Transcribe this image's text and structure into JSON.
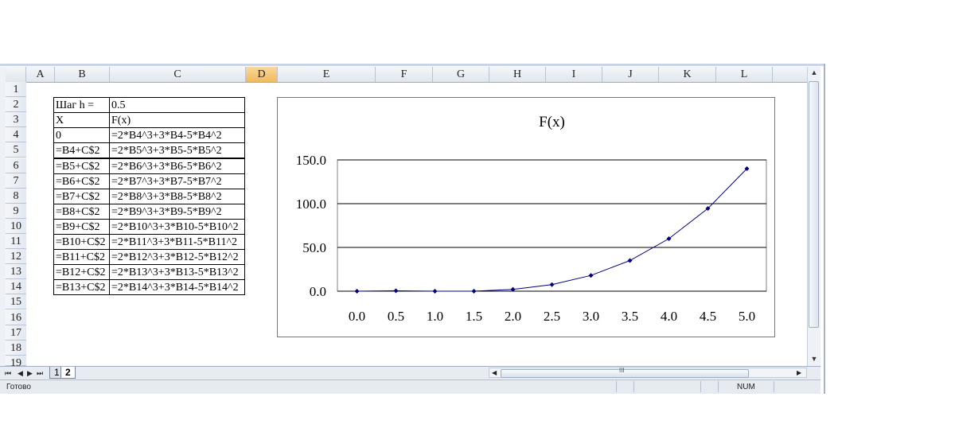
{
  "columns": [
    "A",
    "B",
    "C",
    "D",
    "E",
    "F",
    "G",
    "H",
    "I",
    "J",
    "K",
    "L"
  ],
  "selected_column": "D",
  "rows": [
    "1",
    "2",
    "3",
    "4",
    "5",
    "6",
    "7",
    "8",
    "9",
    "10",
    "11",
    "12",
    "13",
    "14",
    "15",
    "16",
    "17",
    "18",
    "19"
  ],
  "table": [
    [
      "Шаг h =",
      "0.5"
    ],
    [
      "X",
      "F(x)"
    ],
    [
      "0",
      "=2*B4^3+3*B4-5*B4^2"
    ],
    [
      "=B4+C$2",
      "=2*B5^3+3*B5-5*B5^2"
    ],
    [
      "=B5+C$2",
      "=2*B6^3+3*B6-5*B6^2"
    ],
    [
      "=B6+C$2",
      "=2*B7^3+3*B7-5*B7^2"
    ],
    [
      "=B7+C$2",
      "=2*B8^3+3*B8-5*B8^2"
    ],
    [
      "=B8+C$2",
      "=2*B9^3+3*B9-5*B9^2"
    ],
    [
      "=B9+C$2",
      "=2*B10^3+3*B10-5*B10^2"
    ],
    [
      "=B10+C$2",
      "=2*B11^3+3*B11-5*B11^2"
    ],
    [
      "=B11+C$2",
      "=2*B12^3+3*B12-5*B12^2"
    ],
    [
      "=B12+C$2",
      "=2*B13^3+3*B13-5*B13^2"
    ],
    [
      "=B13+C$2",
      "=2*B14^3+3*B14-5*B14^2"
    ]
  ],
  "chart_data": {
    "type": "line",
    "title": "F(x)",
    "xlabel": "",
    "ylabel": "",
    "categories": [
      "0.0",
      "0.5",
      "1.0",
      "1.5",
      "2.0",
      "2.5",
      "3.0",
      "3.5",
      "4.0",
      "4.5",
      "5.0"
    ],
    "series": [
      {
        "values": [
          0,
          0.5,
          0,
          0,
          2,
          7.5,
          18,
          35,
          60,
          94.5,
          140
        ]
      }
    ],
    "ylim": [
      0,
      150
    ],
    "yticks": [
      "0.0",
      "50.0",
      "100.0",
      "150.0"
    ],
    "grid": true,
    "legend": "none",
    "line_color": "#000080",
    "marker_color": "#000080"
  },
  "sheet_tabs": [
    "1",
    "2"
  ],
  "active_tab": "2",
  "nav_buttons": [
    "⏮",
    "◀",
    "▶",
    "⏭"
  ],
  "status": {
    "ready": "Готово",
    "num": "NUM"
  },
  "scroll": {
    "up": "▲",
    "down": "▼",
    "left": "◀",
    "right": "▶",
    "grip": "III"
  }
}
